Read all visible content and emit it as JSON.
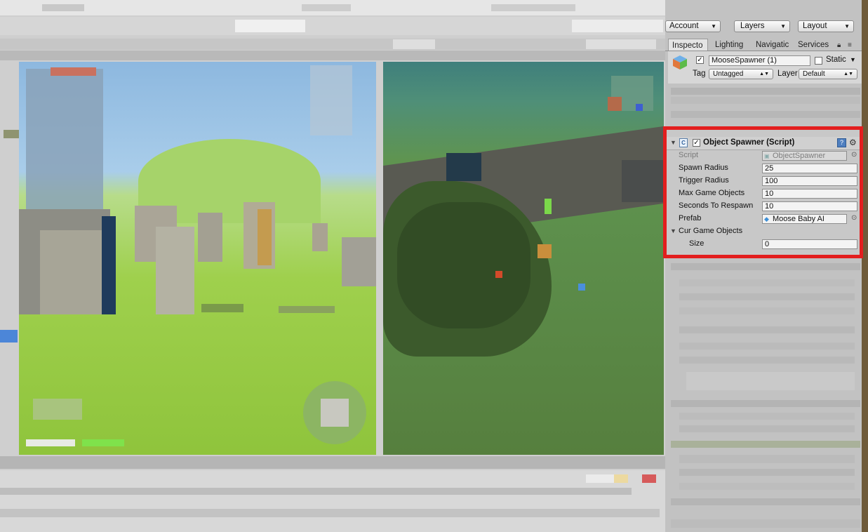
{
  "colors": {
    "highlight": "#e31e1e",
    "panel_bg": "#c2c2c2",
    "field_bg": "#f3f3f3"
  },
  "toolbar": {
    "account": "Account",
    "layers": "Layers",
    "layout": "Layout"
  },
  "tabs": [
    "Inspecto",
    "Lighting",
    "Navigatic",
    "Services"
  ],
  "object": {
    "name": "MooseSpawner (1)",
    "active": true,
    "static_label": "Static",
    "static": false,
    "tag_label": "Tag",
    "tag_value": "Untagged",
    "layer_label": "Layer",
    "layer_value": "Default"
  },
  "component": {
    "title": "Object Spawner (Script)",
    "enabled": true,
    "script_label": "Script",
    "script_value": "ObjectSpawner",
    "fields": [
      {
        "label": "Spawn Radius",
        "value": "25"
      },
      {
        "label": "Trigger Radius",
        "value": "100"
      },
      {
        "label": "Max Game Objects",
        "value": "10"
      },
      {
        "label": "Seconds To Respawn",
        "value": "10"
      }
    ],
    "prefab_label": "Prefab",
    "prefab_value": "Moose Baby AI",
    "list_label": "Cur Game Objects",
    "size_label": "Size",
    "size_value": "0"
  }
}
